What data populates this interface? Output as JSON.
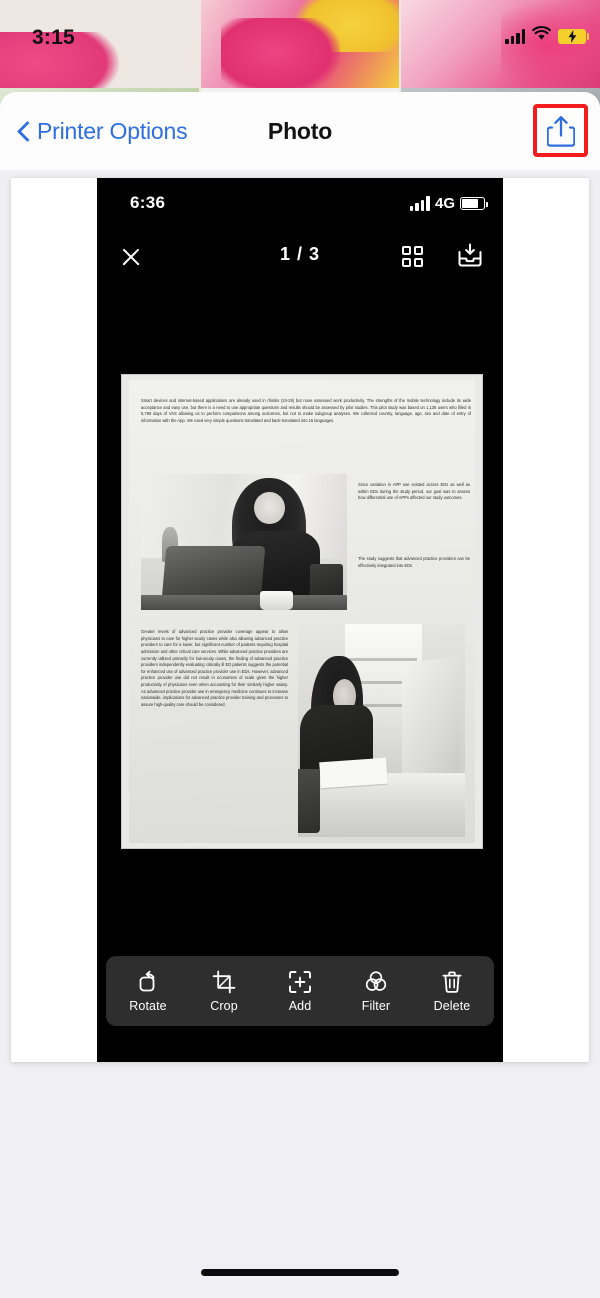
{
  "outer_status": {
    "time": "3:15",
    "signal_icon": "cellular-signal-icon",
    "wifi_icon": "wifi-icon",
    "battery_icon": "battery-charging-icon"
  },
  "nav": {
    "back_label": "Printer Options",
    "back_icon": "chevron-left-icon",
    "title": "Photo",
    "share_icon": "share-icon",
    "highlight_color": "#f21e1e",
    "accent_color": "#2e6ee0"
  },
  "preview": {
    "inner_status": {
      "time": "6:36",
      "network": "4G",
      "signal_icon": "cellular-signal-icon",
      "battery_icon": "battery-icon"
    },
    "top_toolbar": {
      "close_icon": "close-icon",
      "page_counter": "1 / 3",
      "grid_icon": "grid-view-icon",
      "save_icon": "save-to-tray-icon"
    },
    "document": {
      "para_intro": "Smart devices and internet-based applications are already used in rhinitis (24-29) but none assessed work productivity. The strengths of the mobile technology include its wide acceptance and easy use, but there is a need to use appropriate questions and results should be assessed by pilot studies. This pilot study was based on 1,136 users who filled in 5,789 days of VAS allowing us to perform comparisons among outcomes, but not to make subgroup analyses. We collected country, language, age, sex and date of entry of information with the App. We used very simple questions translated and back-translated into 15 languages.",
      "para_right_top": "Since variation in APP use existed across EDs as well as within EDs during the study period, our goal was to assess how differential use of APPs affected our study outcomes.",
      "para_right_bottom": "The study suggests that advanced practice providers can be effectively integrated into EDs",
      "para_lower_left": "Greater levels of advanced practice provider coverage appear to allow physicians to care for higher-acuity cases while also allowing advanced practice providers to care for a lower, but significant number of patients requiring hospital admission and other critical care services. While advanced practice providers are currently utilized primarily for low-acuity cases, the finding of advanced practice providers independently evaluating critically ill ED patients suggests the potential for enhanced use of advanced practice provider use in EDs. However, advanced practice provider use did not result in economies of scale given the higher productivity of physicians even when accounting for their similarly higher salary. As advanced practice provider use in emergency medicine continues to increase nationwide, implications for advanced practice provider training and processes to assure high-quality care should be considered.",
      "photo_laptop_alt": "woman laughing at laptop",
      "photo_writing_alt": "woman writing at desk"
    },
    "edit_toolbar": [
      {
        "label": "Rotate",
        "icon": "rotate-icon"
      },
      {
        "label": "Crop",
        "icon": "crop-icon"
      },
      {
        "label": "Add",
        "icon": "add-page-icon"
      },
      {
        "label": "Filter",
        "icon": "filter-icon"
      },
      {
        "label": "Delete",
        "icon": "trash-icon"
      }
    ]
  },
  "home_indicator": "home-indicator"
}
